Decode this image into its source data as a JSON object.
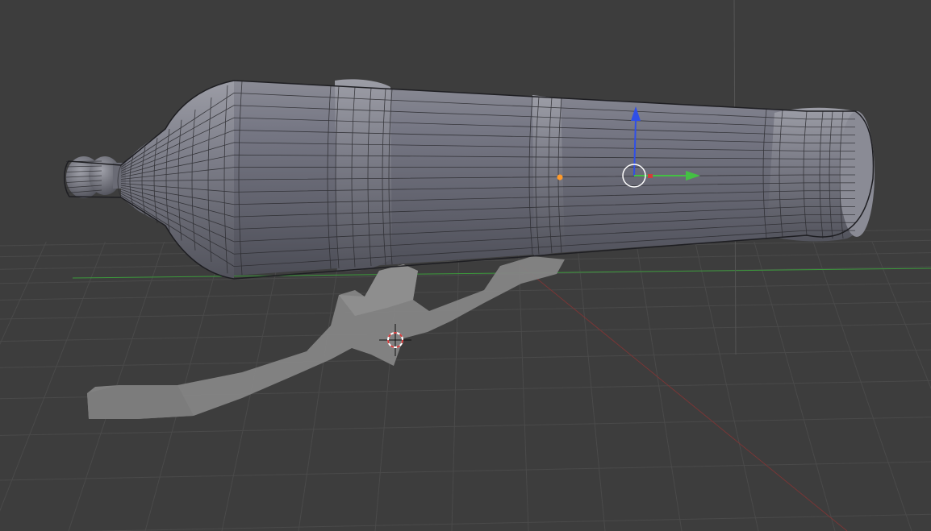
{
  "viewport": {
    "mode": "3d-viewport",
    "colors": {
      "background": "#3d3d3d",
      "grid_line": "#4a4a4a",
      "x_axis": "#8a3a3a",
      "y_axis": "#4fa14f",
      "z_axis": "#555555",
      "mesh_fill": "#6f6f78",
      "mesh_wire": "#2a2a2e",
      "selection_outline": "#ff9a2a",
      "gizmo_x": "#d33b3b",
      "gizmo_y": "#44c044",
      "gizmo_z": "#2f4fe8",
      "carriage": "#8a8a8a"
    },
    "objects": [
      {
        "name": "cannon-barrel",
        "kind": "mesh",
        "display": "solid-wireframe"
      },
      {
        "name": "cannon-carriage",
        "kind": "mesh",
        "display": "solid"
      }
    ],
    "tools": {
      "transform_gizmo": "translate",
      "cursor": "3d-cursor"
    }
  }
}
